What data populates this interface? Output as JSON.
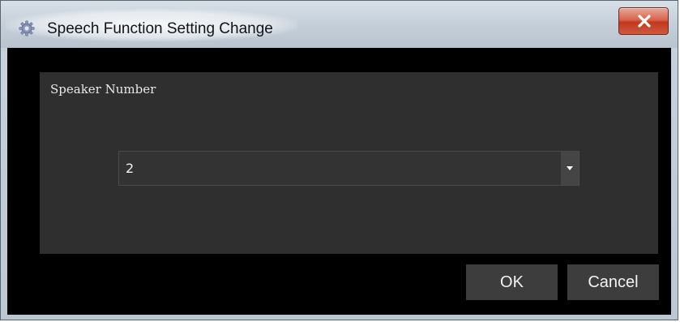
{
  "window": {
    "title": "Speech Function Setting Change",
    "app_icon": "gear-icon",
    "close_icon": "close-icon",
    "colors": {
      "title_bar": "#c9d3dd",
      "close_button": "#c9432b",
      "client_background": "#000000",
      "panel_background": "#2f2f2f",
      "button_background": "#3d3d3d"
    }
  },
  "panel": {
    "label": "Speaker Number",
    "speaker_select": {
      "value": "2",
      "arrow_icon": "chevron-down-icon"
    }
  },
  "buttons": {
    "ok_label": "OK",
    "cancel_label": "Cancel"
  }
}
